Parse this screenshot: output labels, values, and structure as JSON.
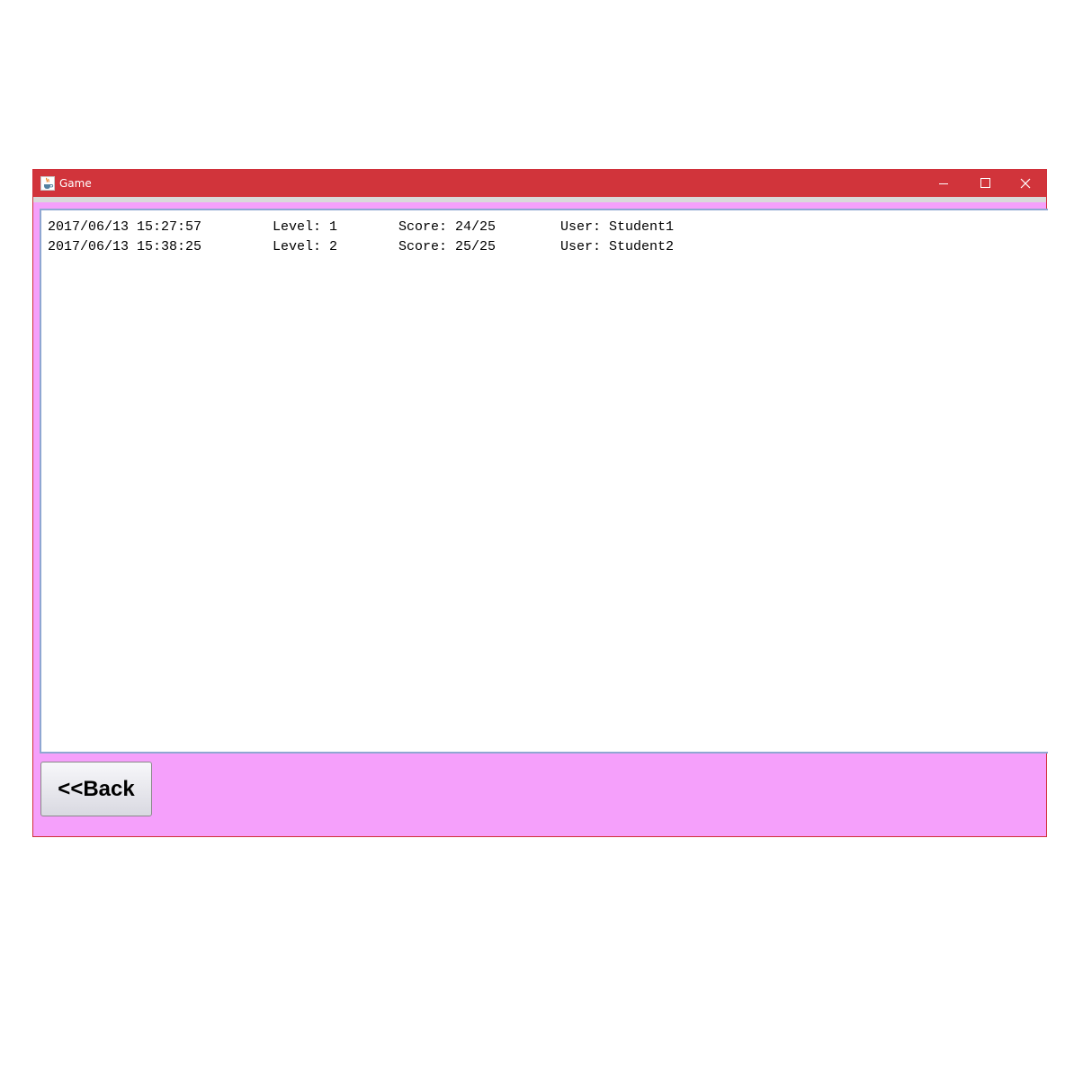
{
  "window": {
    "title": "Game",
    "title_icon": "java-cup-icon",
    "controls": [
      "minimize-icon",
      "maximize-icon",
      "close-icon"
    ],
    "titlebar_color": "#d1343b",
    "background_color": "#f5a0fb"
  },
  "records": [
    {
      "date": "2017/06/13 15:27:57",
      "level": "Level: 1",
      "score": "Score: 24/25",
      "user": "User: Student1"
    },
    {
      "date": "2017/06/13 15:38:25",
      "level": "Level: 2",
      "score": "Score: 25/25",
      "user": "User: Student2"
    }
  ],
  "back_button": {
    "label": "<<Back"
  }
}
